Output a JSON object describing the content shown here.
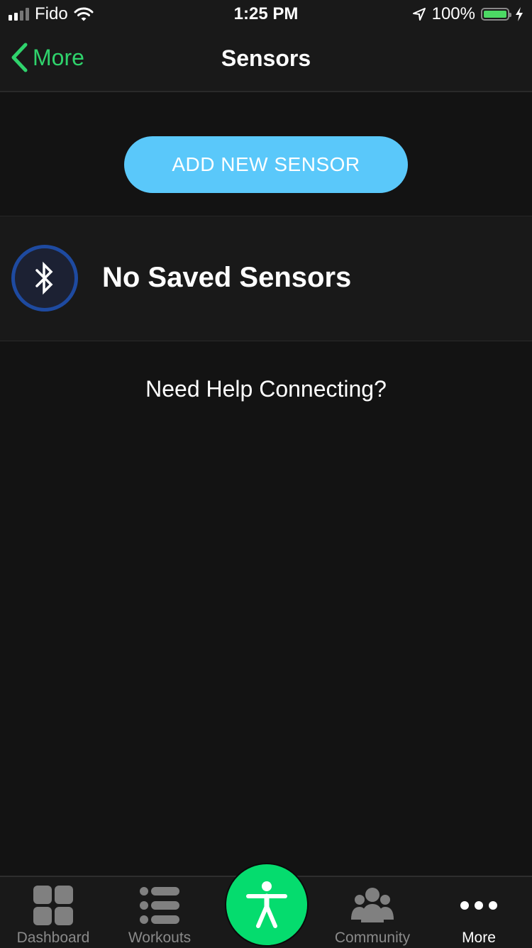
{
  "status_bar": {
    "carrier": "Fido",
    "time": "1:25 PM",
    "battery_percent": "100%",
    "battery_level": 1.0,
    "signal_bars_filled": 2,
    "signal_bars_total": 4
  },
  "nav": {
    "back_label": "More",
    "title": "Sensors"
  },
  "main": {
    "add_button_label": "ADD NEW SENSOR",
    "empty_label": "No Saved Sensors",
    "help_link": "Need Help Connecting?"
  },
  "tabbar": {
    "items": [
      {
        "label": "Dashboard",
        "icon": "grid-icon"
      },
      {
        "label": "Workouts",
        "icon": "list-icon"
      },
      {
        "label": "",
        "icon": "person-icon"
      },
      {
        "label": "Community",
        "icon": "group-icon"
      },
      {
        "label": "More",
        "icon": "more-dots-icon",
        "active": true
      }
    ]
  },
  "colors": {
    "accent_green": "#2fd36c",
    "button_blue": "#5ac8fa",
    "center_green": "#05dc6e",
    "bluetooth_ring": "#1e4aa0"
  }
}
